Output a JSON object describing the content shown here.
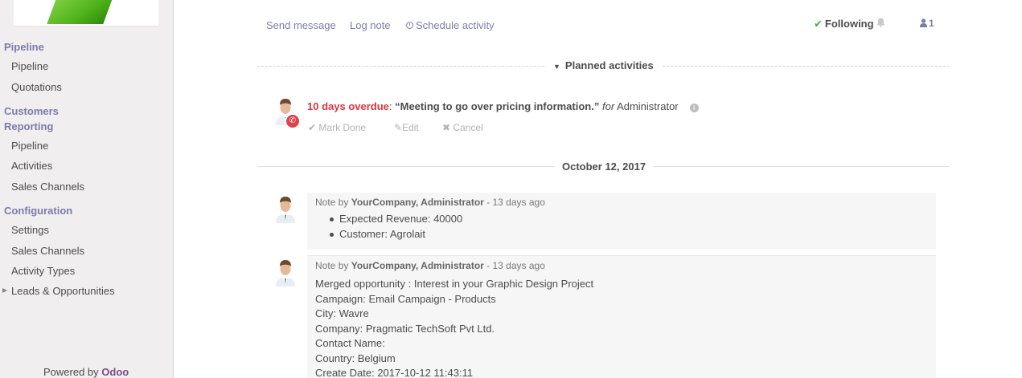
{
  "sidebar": {
    "sections": [
      {
        "label": "Pipeline",
        "items": [
          "Pipeline",
          "Quotations"
        ]
      },
      {
        "label": "Customers",
        "items": []
      },
      {
        "label": "Reporting",
        "items": [
          "Pipeline",
          "Activities",
          "Sales Channels"
        ]
      },
      {
        "label": "Configuration",
        "items": [
          "Settings",
          "Sales Channels",
          "Activity Types",
          "Leads & Opportunities"
        ]
      }
    ],
    "powered_prefix": "Powered by",
    "powered_brand": "Odoo"
  },
  "chatter": {
    "send_message": "Send message",
    "log_note": "Log note",
    "schedule_activity": "Schedule activity",
    "following": "Following",
    "followers_count": "1"
  },
  "planned": {
    "title": "Planned activities",
    "overdue": "10 days overdue",
    "summary": "“Meeting to go over pricing information.”",
    "for_word": "for",
    "assignee": "Administrator",
    "mark_done": "Mark Done",
    "edit": "Edit",
    "cancel": "Cancel"
  },
  "date_separator": "October 12, 2017",
  "messages": [
    {
      "kind": "Note by",
      "author": "YourCompany, Administrator",
      "time": "- 13 days ago",
      "bullets": [
        "Expected Revenue: 40000",
        "Customer: Agrolait"
      ]
    },
    {
      "kind": "Note by",
      "author": "YourCompany, Administrator",
      "time": "- 13 days ago",
      "lines": [
        "Merged opportunity : Interest in your Graphic Design Project",
        "Campaign: Email Campaign - Products",
        "City: Wavre",
        "Company: Pragmatic TechSoft Pvt Ltd.",
        "Contact Name:",
        "Country: Belgium",
        "Create Date: 2017-10-12 11:43:11"
      ]
    }
  ],
  "colors": {
    "accent": "#7c7bad",
    "overdue": "#d9363e",
    "phone_badge": "#e0414b",
    "check": "#3cb043",
    "brand": "#7c4a87"
  },
  "icons": {
    "activity_type": "phone-icon",
    "following": "check-icon",
    "notifications": "bell-icon",
    "followers": "user-icon"
  }
}
